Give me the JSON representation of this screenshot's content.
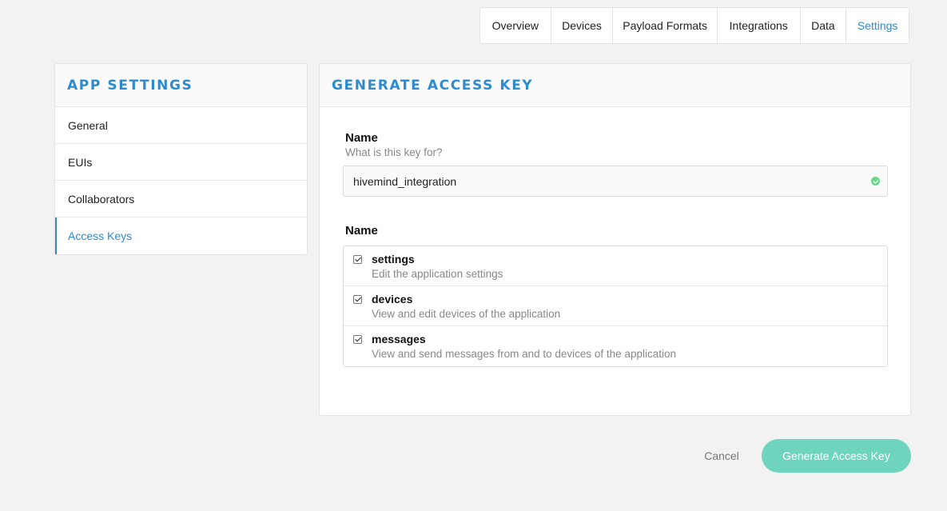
{
  "tabs": [
    {
      "label": "Overview"
    },
    {
      "label": "Devices"
    },
    {
      "label": "Payload Formats"
    },
    {
      "label": "Integrations"
    },
    {
      "label": "Data"
    },
    {
      "label": "Settings"
    }
  ],
  "active_tab": "Settings",
  "sidebar": {
    "title": "APP SETTINGS",
    "items": [
      {
        "label": "General"
      },
      {
        "label": "EUIs"
      },
      {
        "label": "Collaborators"
      },
      {
        "label": "Access Keys"
      }
    ],
    "active_item": "Access Keys"
  },
  "main": {
    "title": "GENERATE ACCESS KEY",
    "name_field": {
      "label": "Name",
      "help": "What is this key for?",
      "value": "hivemind_integration",
      "valid_icon": "check-circle-icon"
    },
    "rights": {
      "label": "Name",
      "items": [
        {
          "name": "settings",
          "description": "Edit the application settings",
          "checked": true
        },
        {
          "name": "devices",
          "description": "View and edit devices of the application",
          "checked": true
        },
        {
          "name": "messages",
          "description": "View and send messages from and to devices of the application",
          "checked": true
        }
      ]
    }
  },
  "footer": {
    "cancel_label": "Cancel",
    "submit_label": "Generate Access Key"
  },
  "colors": {
    "accent": "#2d8bd0",
    "primary_button": "#6fd4bd",
    "valid": "#6cd68b",
    "background": "#f2f2f2"
  }
}
